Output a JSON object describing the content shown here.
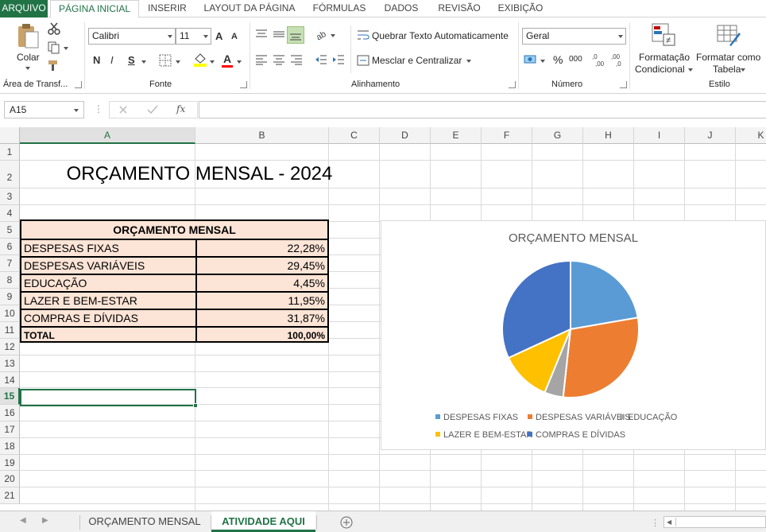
{
  "ribbon_tabs": [
    "ARQUIVO",
    "PÁGINA INICIAL",
    "INSERIR",
    "LAYOUT DA PÁGINA",
    "FÓRMULAS",
    "DADOS",
    "REVISÃO",
    "EXIBIÇÃO"
  ],
  "ribbon": {
    "clipboard": {
      "paste_label": "Colar",
      "group_label": "Área de Transf..."
    },
    "font": {
      "name": "Calibri",
      "size": "11",
      "bold": "N",
      "italic": "I",
      "underline": "S",
      "grow": "A",
      "shrink": "A",
      "color_letter": "A",
      "group_label": "Fonte"
    },
    "alignment": {
      "wrap_text": "Quebrar Texto Automaticamente",
      "merge_center": "Mesclar e Centralizar",
      "group_label": "Alinhamento"
    },
    "number": {
      "format": "Geral",
      "percent": "%",
      "thousands": "000",
      "group_label": "Número"
    },
    "styles": {
      "conditional_line1": "Formatação",
      "conditional_line2": "Condicional",
      "table_line1": "Formatar como",
      "table_line2": "Tabela",
      "group_label": "Estilo"
    }
  },
  "formula_bar": {
    "name_box": "A15",
    "fx": "fx",
    "content": ""
  },
  "columns": [
    "A",
    "B",
    "C",
    "D",
    "E",
    "F",
    "G",
    "H",
    "I",
    "J",
    "K"
  ],
  "rows": [
    "1",
    "2",
    "3",
    "4",
    "5",
    "6",
    "7",
    "8",
    "9",
    "10",
    "11",
    "12",
    "13",
    "14",
    "15",
    "16",
    "17",
    "18",
    "19",
    "20",
    "21"
  ],
  "selected_cell": "A15",
  "sheet": {
    "title": "ORÇAMENTO MENSAL - 2024",
    "table_header": "ORÇAMENTO MENSAL",
    "items": [
      {
        "label": "DESPESAS FIXAS",
        "value": "22,28%"
      },
      {
        "label": "DESPESAS VARIÁVEIS",
        "value": "29,45%"
      },
      {
        "label": "EDUCAÇÃO",
        "value": "4,45%"
      },
      {
        "label": "LAZER E BEM-ESTAR",
        "value": "11,95%"
      },
      {
        "label": "COMPRAS E DÍVIDAS",
        "value": "31,87%"
      }
    ],
    "total_label": "TOTAL",
    "total_value": "100,00%"
  },
  "colors": {
    "excel_green": "#217346",
    "table_fill": "#fce4d6",
    "pie": [
      "#5b9bd5",
      "#ed7d31",
      "#a5a5a5",
      "#ffc000",
      "#4472c4"
    ]
  },
  "chart_data": {
    "type": "pie",
    "title": "ORÇAMENTO MENSAL",
    "categories": [
      "DESPESAS FIXAS",
      "DESPESAS VARIÁVEIS",
      "EDUCAÇÃO",
      "LAZER E BEM-ESTAR",
      "COMPRAS E DÍVIDAS"
    ],
    "values": [
      22.28,
      29.45,
      4.45,
      11.95,
      31.87
    ],
    "legend": "bottom"
  },
  "sheet_tabs": [
    {
      "label": "ORÇAMENTO MENSAL",
      "active": false
    },
    {
      "label": "ATIVIDADE AQUI",
      "active": true
    }
  ]
}
